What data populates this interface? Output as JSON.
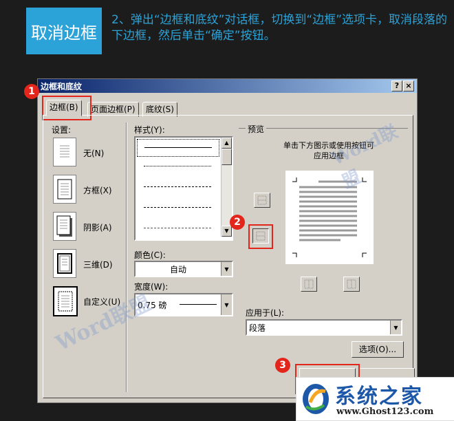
{
  "header": {
    "badge": "取消边框",
    "instruction": "2、弹出“边框和底纹”对话框，切换到“边框”选项卡，取消段落的下边框，然后单击“确定”按钮。"
  },
  "dialog": {
    "title": "边框和底纹",
    "help_btn": "?",
    "close_btn": "×",
    "tabs": [
      "边框(B)",
      "页面边框(P)",
      "底纹(S)"
    ],
    "settings_label": "设置:",
    "settings": [
      "无(N)",
      "方框(X)",
      "阴影(A)",
      "三维(D)",
      "自定义(U)"
    ],
    "style_label": "样式(Y):",
    "color_label": "颜色(C):",
    "color_value": "自动",
    "width_label": "宽度(W):",
    "width_value": "0.75 磅",
    "preview_label": "预览",
    "preview_hint": "单击下方图示或使用按钮可\n应用边框",
    "apply_label": "应用于(L):",
    "apply_value": "段落",
    "options_btn": "选项(O)..."
  },
  "annotations": [
    "1",
    "2",
    "3"
  ],
  "watermark": "Word联盟",
  "logo": {
    "title": "系统之家",
    "url": "www.Ghost123.com"
  },
  "colors": {
    "accent": "#2ba3d9",
    "highlight": "#e2261b",
    "titlebar": "#0a246a"
  }
}
